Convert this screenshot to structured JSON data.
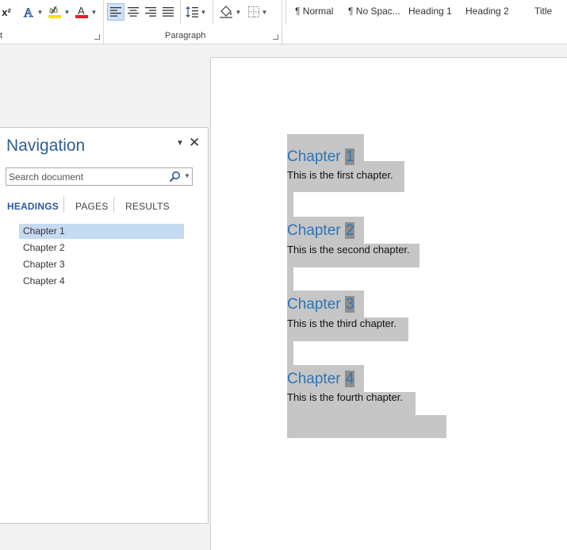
{
  "ribbon": {
    "font_group_label_tail": "t",
    "paragraph_group_label": "Paragraph",
    "superscript_label": "x²",
    "styles": [
      "¶ Normal",
      "¶ No Spac...",
      "Heading 1",
      "Heading 2",
      "Title"
    ],
    "colors": {
      "highlight": "#f5e300",
      "font_color": "#e51c23",
      "accent": "#2b579a"
    }
  },
  "navigation": {
    "title": "Navigation",
    "search_placeholder": "Search document",
    "tabs": [
      "HEADINGS",
      "PAGES",
      "RESULTS"
    ],
    "active_tab": "HEADINGS",
    "headings": [
      "Chapter 1",
      "Chapter 2",
      "Chapter 3",
      "Chapter 4"
    ],
    "selected_heading": "Chapter 1"
  },
  "document": {
    "chapters": [
      {
        "word": "Chapter",
        "number": "1",
        "body": "This is the first chapter."
      },
      {
        "word": "Chapter",
        "number": "2",
        "body": "This is the second chapter."
      },
      {
        "word": "Chapter",
        "number": "3",
        "body": "This is the third chapter."
      },
      {
        "word": "Chapter",
        "number": "4",
        "body": "This is the fourth chapter."
      }
    ],
    "heading_color": "#2e74b5",
    "selection_color": "#c6c6c6"
  }
}
